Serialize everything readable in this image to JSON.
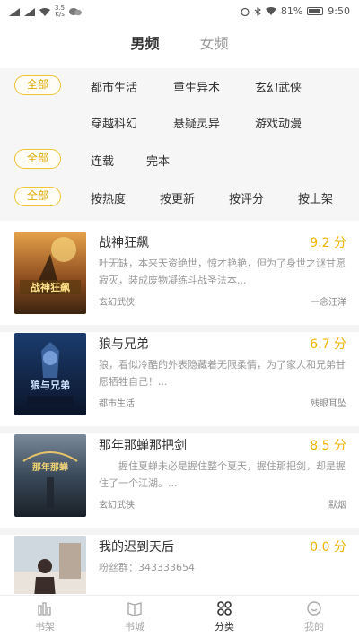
{
  "status_bar": {
    "speed_top": "3.5",
    "speed_bottom": "K/s",
    "battery": "81%",
    "time": "9:50"
  },
  "gender_tabs": [
    {
      "label": "男频",
      "active": true
    },
    {
      "label": "女频",
      "active": false
    }
  ],
  "filters": {
    "category": {
      "all_label": "全部",
      "options": [
        "都市生活",
        "重生异术",
        "玄幻武侠",
        "穿越科幻",
        "悬疑灵异",
        "游戏动漫"
      ]
    },
    "status": {
      "all_label": "全部",
      "options": [
        "连载",
        "完本"
      ]
    },
    "sort": {
      "all_label": "全部",
      "options": [
        "按热度",
        "按更新",
        "按评分",
        "按上架"
      ]
    }
  },
  "books": [
    {
      "title": "战神狂飙",
      "score": "9.2 分",
      "desc": "叶无缺，本来天资绝世，惊才艳艳，但为了身世之谜甘愿寂灭，装成废物凝练斗战圣法本...",
      "category": "玄幻武侠",
      "author": "一念汪洋"
    },
    {
      "title": "狼与兄弟",
      "score": "6.7 分",
      "desc": "狼，看似冷酷的外表隐藏着无限柔情，为了家人和兄弟甘愿牺牲自己！...",
      "category": "都市生活",
      "author": "残眼耳坠"
    },
    {
      "title": "那年那蝉那把剑",
      "score": "8.5 分",
      "desc": "　　握住夏蝉未必是握住整个夏天，握住那把剑，却是握住了一个江湖。...",
      "category": "玄幻武侠",
      "author": "默烟"
    },
    {
      "title": "我的迟到天后",
      "score": "0.0 分",
      "desc": "粉丝群：343333654",
      "category": "",
      "author": ""
    }
  ],
  "bottom_nav": [
    {
      "label": "书架",
      "icon": "bookshelf-icon",
      "active": false
    },
    {
      "label": "书城",
      "icon": "book-city-icon",
      "active": false
    },
    {
      "label": "分类",
      "icon": "category-icon",
      "active": true
    },
    {
      "label": "我的",
      "icon": "profile-icon",
      "active": false
    }
  ],
  "colors": {
    "accent": "#f1c232",
    "score": "#f0b400"
  }
}
